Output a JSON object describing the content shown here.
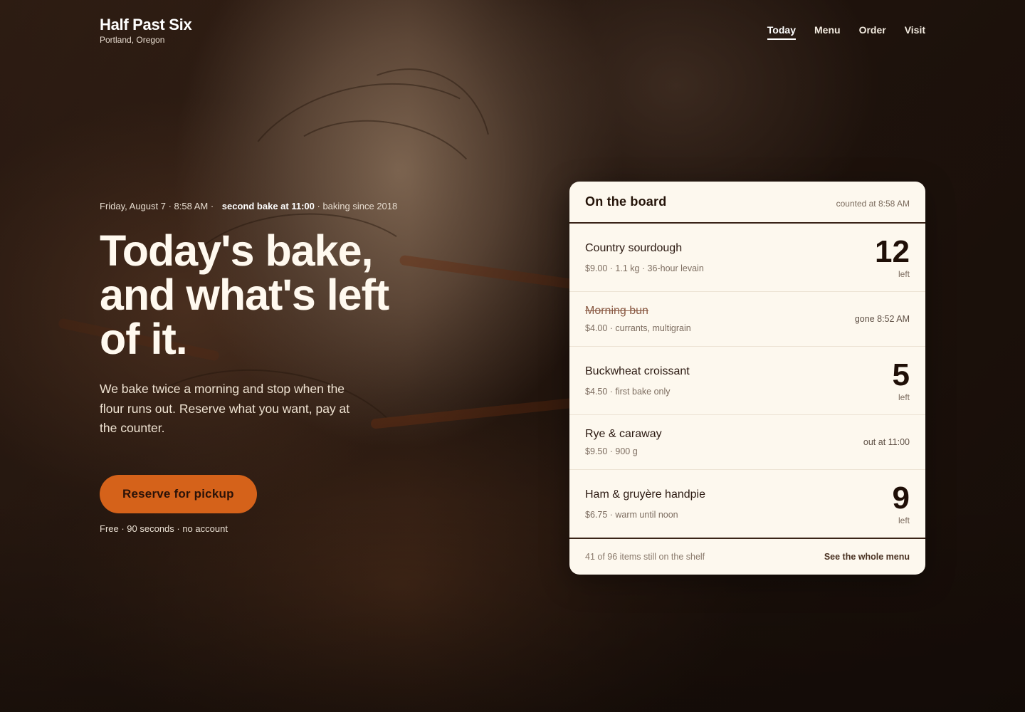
{
  "brand": {
    "name": "Half Past Six",
    "city": "Portland, Oregon"
  },
  "nav": {
    "items": [
      {
        "label": "Today",
        "active": true
      },
      {
        "label": "Menu",
        "active": false
      },
      {
        "label": "Order",
        "active": false
      },
      {
        "label": "Visit",
        "active": false
      }
    ]
  },
  "hero": {
    "meta": {
      "date_time": "Friday, August 7 · 8:58 AM ·",
      "second_bake": "second bake at 11:00",
      "since": "· baking since 2018"
    },
    "headline": "Today's bake, and what's left of it.",
    "lede": "We bake twice a morning and stop when the flour runs out. Reserve what you want, pay at the counter.",
    "cta_label": "Reserve for pickup",
    "cta_note": "Free · 90 seconds · no account"
  },
  "board": {
    "title": "On the board",
    "counted": "counted at 8:58 AM",
    "items": [
      {
        "name": "Country sourdough",
        "detail": "$9.00 · 1.1 kg · 36-hour levain",
        "count": "12",
        "unit": "left",
        "status": ""
      },
      {
        "name": "Morning bun",
        "detail": "$4.00 · currants, multigrain",
        "count": "",
        "unit": "",
        "status": "gone 8:52 AM"
      },
      {
        "name": "Buckwheat croissant",
        "detail": "$4.50 · first bake only",
        "count": "5",
        "unit": "left",
        "status": ""
      },
      {
        "name": "Rye & caraway",
        "detail": "$9.50 · 900 g",
        "count": "",
        "unit": "",
        "status": "out at 11:00"
      },
      {
        "name": "Ham & gruyère handpie",
        "detail": "$6.75 · warm until noon",
        "count": "9",
        "unit": "left",
        "status": ""
      }
    ],
    "footer_count": "41 of 96 items still on the shelf",
    "footer_link": "See the whole menu"
  },
  "colors": {
    "accent": "#d5621a",
    "card": "#fdf8ee",
    "ink": "#2a1810"
  }
}
